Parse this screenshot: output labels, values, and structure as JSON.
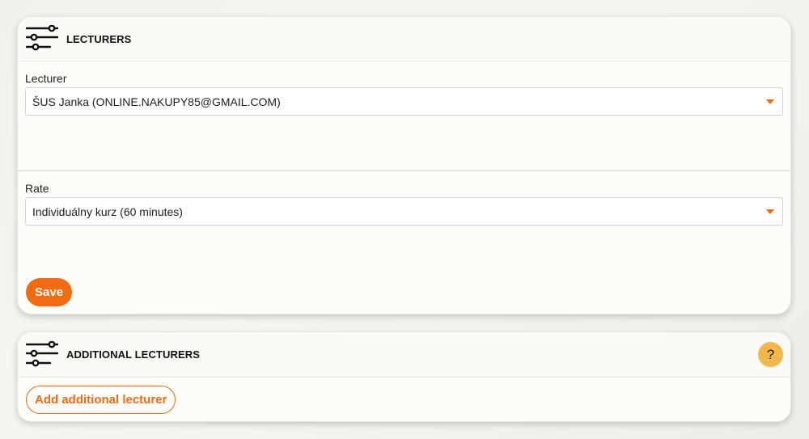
{
  "lecturers_panel": {
    "icon": "sliders-icon",
    "title": "LECTURERS",
    "lecturer_label": "Lecturer",
    "lecturer_value": "ŠUS Janka (ONLINE.NAKUPY85@GMAIL.COM)",
    "rate_label": "Rate",
    "rate_value": "Individuálny kurz (60 minutes)",
    "save_label": "Save"
  },
  "additional_panel": {
    "icon": "sliders-icon",
    "title": "ADDITIONAL LECTURERS",
    "help_label": "?",
    "add_label": "Add additional lecturer"
  },
  "colors": {
    "accent": "#f26a12",
    "help_badge": "#f2b74a",
    "card_background": "#fcfcf8"
  }
}
